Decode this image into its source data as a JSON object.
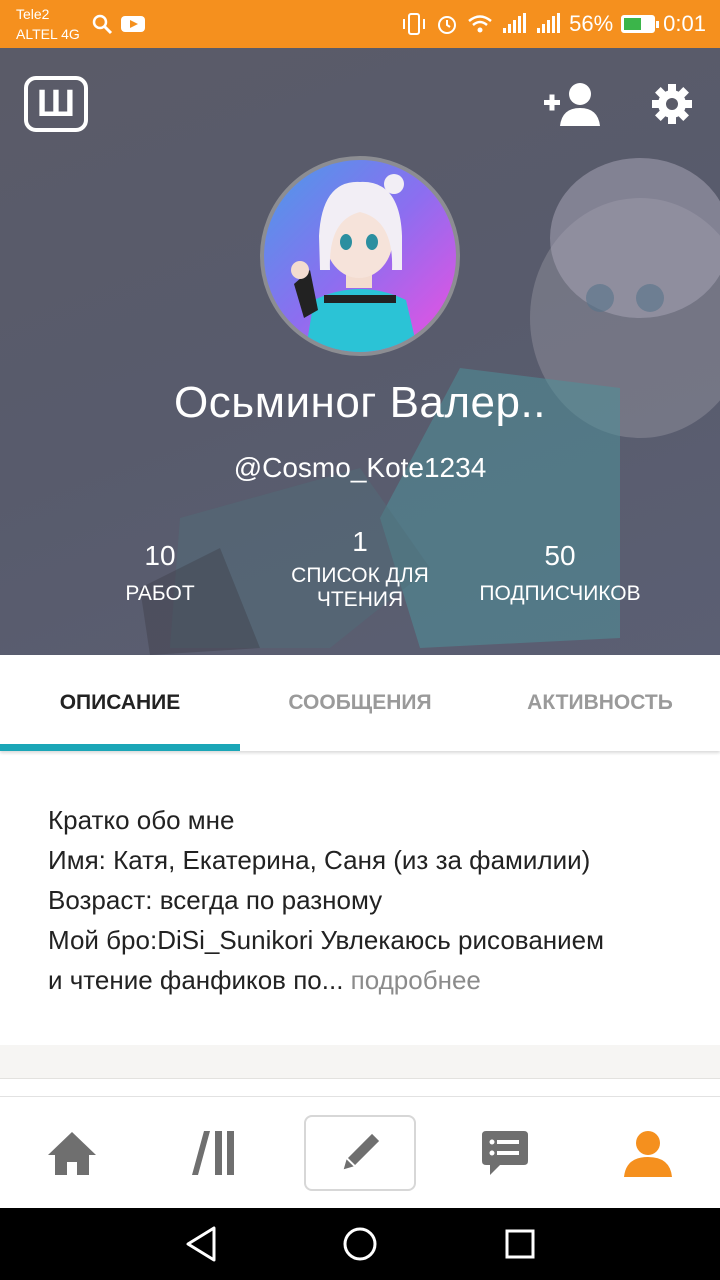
{
  "status_bar": {
    "carrier_line1": "Tele2",
    "carrier_line2": "ALTEL 4G",
    "battery_percent": "56%",
    "battery_level": 0.56,
    "time": "0:01",
    "icons": [
      "search-icon",
      "youtube-icon",
      "vibrate-icon",
      "alarm-icon",
      "wifi-icon",
      "signal-icon",
      "signal-icon",
      "battery-icon"
    ]
  },
  "header": {
    "logo_letter": "Ш",
    "display_name": "Осьминог Валер..",
    "username": "@Cosmo_Kote1234",
    "stats": {
      "works": {
        "value": "10",
        "label": "РАБОТ"
      },
      "reading_lists": {
        "value": "1",
        "label_line1": "СПИСОК ДЛЯ",
        "label_line2": "ЧТЕНИЯ"
      },
      "followers": {
        "value": "50",
        "label": "ПОДПИСЧИКОВ"
      }
    },
    "actions": [
      "add-user-icon",
      "gear-icon"
    ]
  },
  "tabs": [
    {
      "label": "ОПИСАНИЕ",
      "active": true
    },
    {
      "label": "СООБЩЕНИЯ",
      "active": false
    },
    {
      "label": "АКТИВНОСТЬ",
      "active": false
    }
  ],
  "description": {
    "line1": "Кратко обо мне",
    "line2": "Имя: Катя, Екатерина, Саня (из за фамилии)",
    "line3": "Возраст: всегда по разному",
    "line4": "Мой бро:DiSi_Sunikori Увлекаюсь рисованием",
    "line5": "и чтение фанфиков по...",
    "more_link": " подробнее"
  },
  "bottom_nav": [
    "home-icon",
    "library-icon",
    "write-icon",
    "messages-icon",
    "profile-icon"
  ],
  "colors": {
    "status_bar": "#f5901e",
    "accent_tab": "#1aa6b7",
    "profile_active": "#f5901e",
    "nav_icon": "#6f6f6f"
  }
}
